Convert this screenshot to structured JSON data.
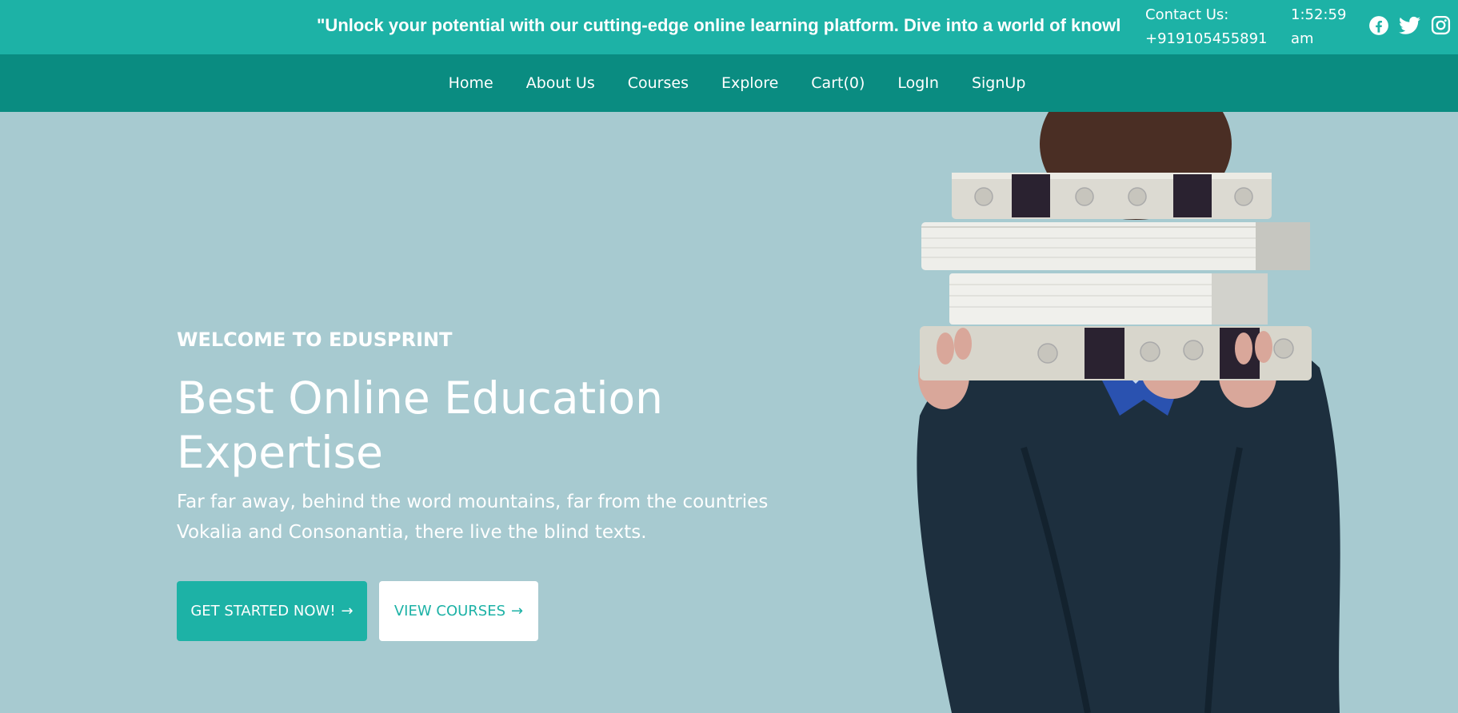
{
  "topbar": {
    "marquee": "\"Unlock your potential with our cutting-edge online learning platform. Dive into a world of knowl",
    "contact_label": "Contact Us:",
    "contact_phone": "+919105455891",
    "time": "1:52:59",
    "time_suffix": "am",
    "socials": [
      "facebook-icon",
      "twitter-icon",
      "instagram-icon"
    ]
  },
  "nav": {
    "items": [
      "Home",
      "About Us",
      "Courses",
      "Explore",
      "Cart(0)",
      "LogIn",
      "SignUp"
    ]
  },
  "hero": {
    "eyebrow": "WELCOME TO EDUSPRINT",
    "headline_line1": "Best Online Education",
    "headline_line2": "Expertise",
    "description": "Far far away, behind the word mountains, far from the countries Vokalia and Consonantia, there live the blind texts.",
    "primary_button": "GET STARTED NOW!",
    "secondary_button": "VIEW COURSES",
    "image_icon": "person-holding-books-icon"
  },
  "colors": {
    "topbar": "#1db2a6",
    "navbar": "#0a8c81",
    "hero_bg": "#a7cad0",
    "accent": "#1db2a6"
  }
}
